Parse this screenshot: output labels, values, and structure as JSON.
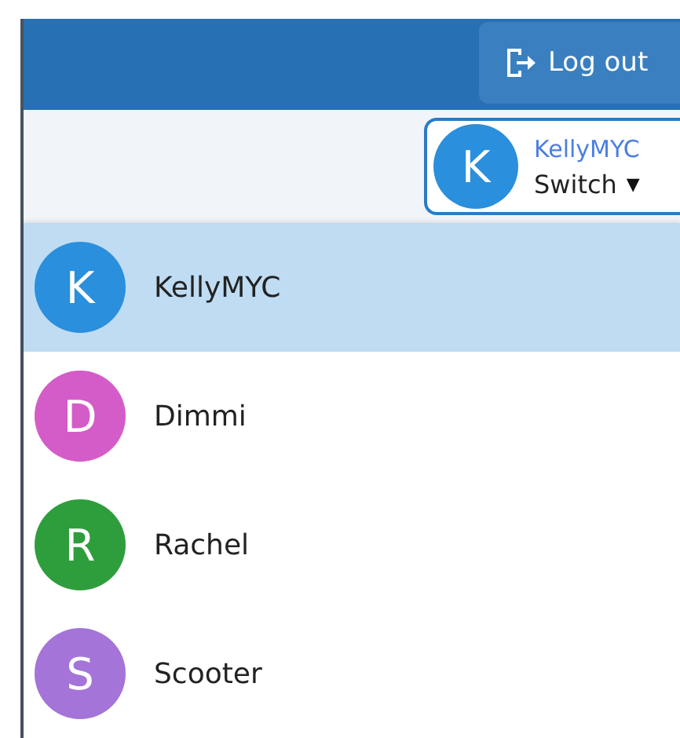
{
  "header": {
    "logout_label": "Log out"
  },
  "account": {
    "initial": "K",
    "color": "#2a8fdc",
    "name": "KellyMYC",
    "switch_label": "Switch",
    "caret": "▼"
  },
  "accounts": [
    {
      "initial": "K",
      "name": "KellyMYC",
      "color": "#2a8fdc",
      "selected": true
    },
    {
      "initial": "D",
      "name": "Dimmi",
      "color": "#d45cc8",
      "selected": false
    },
    {
      "initial": "R",
      "name": "Rachel",
      "color": "#2e9e3c",
      "selected": false
    },
    {
      "initial": "S",
      "name": "Scooter",
      "color": "#a474d8",
      "selected": false
    }
  ]
}
